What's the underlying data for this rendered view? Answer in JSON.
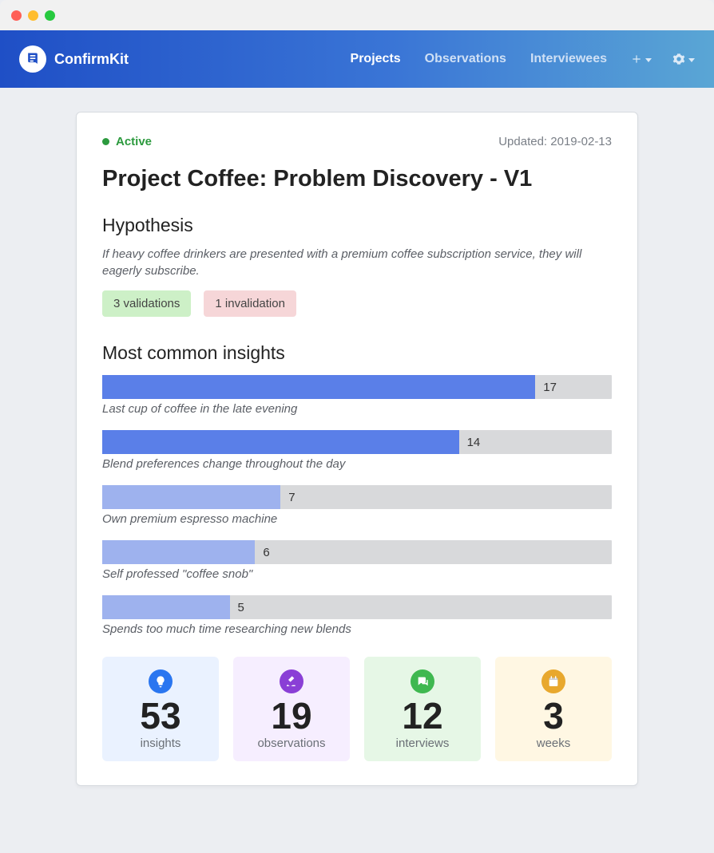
{
  "brand": {
    "name": "ConfirmKit"
  },
  "nav": {
    "links": [
      {
        "label": "Projects",
        "active": true
      },
      {
        "label": "Observations",
        "active": false
      },
      {
        "label": "Interviewees",
        "active": false
      }
    ]
  },
  "status": {
    "label": "Active"
  },
  "updated": {
    "label": "Updated: 2019-02-13"
  },
  "project": {
    "title": "Project Coffee: Problem Discovery - V1"
  },
  "hypothesis": {
    "heading": "Hypothesis",
    "text": "If heavy coffee drinkers are presented with a premium coffee subscription service, they will eagerly subscribe.",
    "validations_label": "3 validations",
    "invalidations_label": "1 invalidation"
  },
  "insights_heading": "Most common insights",
  "chart_data": {
    "type": "bar",
    "max": 20,
    "items": [
      {
        "value": 17,
        "label": "Last cup of coffee in the late evening",
        "intensity": "strong"
      },
      {
        "value": 14,
        "label": "Blend preferences change throughout the day",
        "intensity": "strong"
      },
      {
        "value": 7,
        "label": "Own premium espresso machine",
        "intensity": "light"
      },
      {
        "value": 6,
        "label": "Self professed \"coffee snob\"",
        "intensity": "light"
      },
      {
        "value": 5,
        "label": "Spends too much time researching new blends",
        "intensity": "light"
      }
    ]
  },
  "stats": [
    {
      "value": "53",
      "label": "insights",
      "color": "blue",
      "icon": "bulb"
    },
    {
      "value": "19",
      "label": "observations",
      "color": "purple",
      "icon": "microscope"
    },
    {
      "value": "12",
      "label": "interviews",
      "color": "green",
      "icon": "chat"
    },
    {
      "value": "3",
      "label": "weeks",
      "color": "yellow",
      "icon": "calendar"
    }
  ]
}
